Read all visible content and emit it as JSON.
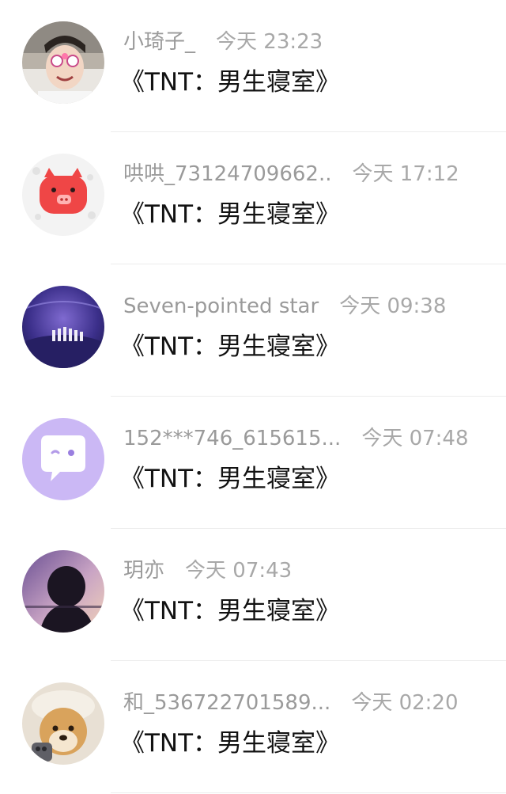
{
  "messages": [
    {
      "name": "小琦子_",
      "time": "今天 23:23",
      "text": "《TNT：男生寝室》",
      "avatar_icon": "boy-with-glasses-photo"
    },
    {
      "name": "哄哄_73124709662..",
      "time": "今天 17:12",
      "text": "《TNT：男生寝室》",
      "avatar_icon": "red-pig-sticker"
    },
    {
      "name": "Seven-pointed star",
      "time": "今天 09:38",
      "text": "《TNT：男生寝室》",
      "avatar_icon": "stage-group-photo"
    },
    {
      "name": "152***746_615615...",
      "time": "今天 07:48",
      "text": "《TNT：男生寝室》",
      "avatar_icon": "purple-chat-bubble-default"
    },
    {
      "name": "玥亦",
      "time": "今天 07:43",
      "text": "《TNT：男生寝室》",
      "avatar_icon": "silhouette-sunset-photo"
    },
    {
      "name": "和_536722701589...",
      "time": "今天 02:20",
      "text": "《TNT：男生寝室》",
      "avatar_icon": "shiba-dog-photo"
    }
  ],
  "colors": {
    "name_text": "#9a9a9a",
    "message_text": "#121212",
    "divider": "#ececec",
    "default_avatar_bg": "#cbb8f5"
  }
}
